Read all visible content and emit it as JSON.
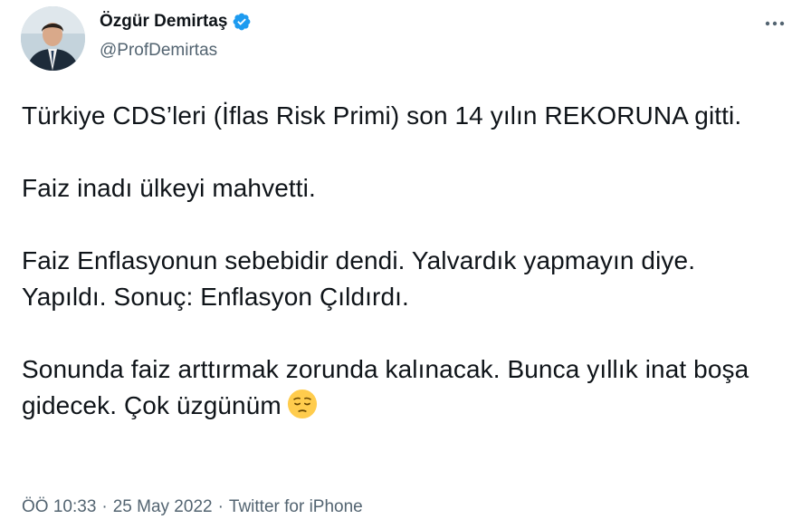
{
  "author": {
    "display_name": "Özgür Demirtaş",
    "handle": "@ProfDemirtas",
    "verified": true
  },
  "tweet": {
    "paragraphs": [
      "Türkiye CDS’leri (İflas Risk Primi) son 14 yılın REKORUNA gitti.",
      "Faiz inadı ülkeyi mahvetti.",
      "Faiz Enflasyonun sebebidir dendi. Yalvardık yapmayın diye. Yapıldı. Sonuç: Enflasyon Çıldırdı.",
      "Sonunda faiz arttırmak zorunda kalınacak. Bunca yıllık inat boşa gidecek. Çok üzgünüm"
    ],
    "emoji": "pensive-face"
  },
  "meta": {
    "time": "ÖÖ 10:33",
    "separator": "·",
    "date": "25 May 2022",
    "source": "Twitter for iPhone"
  },
  "icons": {
    "verified": "verified-badge-icon",
    "more": "more-options-icon"
  },
  "colors": {
    "text": "#0f1419",
    "secondary": "#536471",
    "verified": "#1d9bf0",
    "emoji": "#ffcc4d"
  }
}
